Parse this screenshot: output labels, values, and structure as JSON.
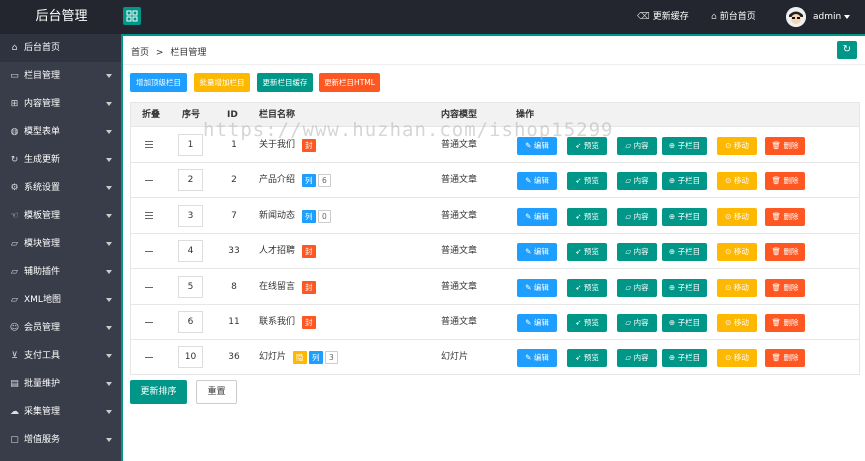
{
  "app": {
    "title": "后台管理"
  },
  "header": {
    "update_cache": "更新缓存",
    "front_home": "前台首页",
    "user": "admin"
  },
  "sidebar": {
    "items": [
      {
        "label": "后台首页",
        "icon": "home-icon",
        "has_caret": false
      },
      {
        "label": "栏目管理",
        "icon": "monitor-icon",
        "has_caret": true
      },
      {
        "label": "内容管理",
        "icon": "grid-icon",
        "has_caret": true
      },
      {
        "label": "模型表单",
        "icon": "globe-icon",
        "has_caret": true
      },
      {
        "label": "生成更新",
        "icon": "refresh-icon",
        "has_caret": true
      },
      {
        "label": "系统设置",
        "icon": "gear-icon",
        "has_caret": true
      },
      {
        "label": "模板管理",
        "icon": "hand-icon",
        "has_caret": true
      },
      {
        "label": "模块管理",
        "icon": "folder-icon",
        "has_caret": true
      },
      {
        "label": "辅助插件",
        "icon": "folder-icon",
        "has_caret": true
      },
      {
        "label": "XML地图",
        "icon": "folder-icon",
        "has_caret": true
      },
      {
        "label": "会员管理",
        "icon": "user-icon",
        "has_caret": true
      },
      {
        "label": "支付工具",
        "icon": "cart-icon",
        "has_caret": true
      },
      {
        "label": "批量维护",
        "icon": "chart-icon",
        "has_caret": true
      },
      {
        "label": "采集管理",
        "icon": "cloud-icon",
        "has_caret": true
      },
      {
        "label": "增值服务",
        "icon": "message-icon",
        "has_caret": true
      }
    ]
  },
  "breadcrumb": {
    "home": "首页",
    "sep": ">",
    "current": "栏目管理"
  },
  "actions": {
    "add_top": "增加顶级栏目",
    "batch_add": "批量增加栏目",
    "update_cache": "更新栏目缓存",
    "update_html": "更新栏目HTML"
  },
  "table": {
    "headers": {
      "fold": "折叠",
      "sort": "序号",
      "id": "ID",
      "name": "栏目名称",
      "model": "内容模型",
      "ops": "操作"
    },
    "op_labels": {
      "edit": "编辑",
      "preview": "预览",
      "content": "内容",
      "child": "子栏目",
      "move": "移动",
      "delete": "删除"
    },
    "rows": [
      {
        "fold": "expand",
        "sort": "1",
        "id": "1",
        "name": "关于我们",
        "tags": [
          {
            "text": "封",
            "color": "red"
          }
        ],
        "model": "普通文章"
      },
      {
        "fold": "collapse",
        "sort": "2",
        "id": "2",
        "name": "产品介绍",
        "tags": [
          {
            "text": "列",
            "color": "blue"
          },
          {
            "text": "6",
            "color": "count"
          }
        ],
        "model": "普通文章"
      },
      {
        "fold": "expand",
        "sort": "3",
        "id": "7",
        "name": "新闻动态",
        "tags": [
          {
            "text": "列",
            "color": "blue"
          },
          {
            "text": "0",
            "color": "count"
          }
        ],
        "model": "普通文章"
      },
      {
        "fold": "collapse",
        "sort": "4",
        "id": "33",
        "name": "人才招聘",
        "tags": [
          {
            "text": "封",
            "color": "red"
          }
        ],
        "model": "普通文章"
      },
      {
        "fold": "collapse",
        "sort": "5",
        "id": "8",
        "name": "在线留言",
        "tags": [
          {
            "text": "封",
            "color": "red"
          }
        ],
        "model": "普通文章"
      },
      {
        "fold": "collapse",
        "sort": "6",
        "id": "11",
        "name": "联系我们",
        "tags": [
          {
            "text": "封",
            "color": "red"
          }
        ],
        "model": "普通文章"
      },
      {
        "fold": "collapse",
        "sort": "10",
        "id": "36",
        "name": "幻灯片",
        "tags": [
          {
            "text": "隐",
            "color": "yellow"
          },
          {
            "text": "列",
            "color": "blue"
          },
          {
            "text": "3",
            "color": "count"
          }
        ],
        "model": "幻灯片"
      }
    ]
  },
  "footer": {
    "update_sort": "更新排序",
    "reset": "重置"
  },
  "watermark": "https://www.huzhan.com/ishop15299",
  "colors": {
    "accent": "#009688",
    "blue": "#1e9fff",
    "yellow": "#ffb800",
    "red": "#ff5722",
    "sidebar": "#393d49",
    "topbar": "#23262e"
  }
}
